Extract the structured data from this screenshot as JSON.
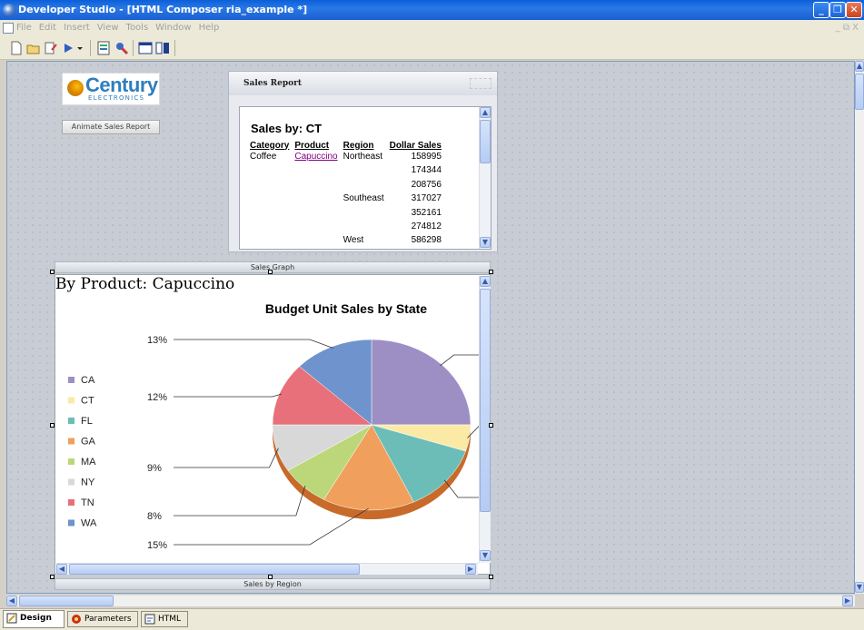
{
  "window": {
    "title": "Developer Studio - [HTML Composer ria_example *]"
  },
  "menu": [
    "File",
    "Edit",
    "Insert",
    "View",
    "Tools",
    "Window",
    "Help"
  ],
  "mdi_controls": "_ ⧉ X",
  "logo": {
    "name": "Century",
    "sub": "ELECTRONICS"
  },
  "animate_button": "Animate Sales Report",
  "report": {
    "frame_title": "Sales Report",
    "title": "Sales by: CT",
    "columns": [
      "Category",
      "Product",
      "Region",
      "Dollar Sales"
    ],
    "rows": [
      [
        "Coffee",
        "Capuccino",
        "Northeast",
        "158995"
      ],
      [
        "",
        "",
        "",
        "174344"
      ],
      [
        "",
        "",
        "",
        "208756"
      ],
      [
        "",
        "",
        "Southeast",
        "317027"
      ],
      [
        "",
        "",
        "",
        "352161"
      ],
      [
        "",
        "",
        "",
        "274812"
      ],
      [
        "",
        "",
        "West",
        "586298"
      ]
    ]
  },
  "graph": {
    "frame_label": "Sales Graph",
    "heading": "By Product: Capuccino",
    "bottom_label": "Sales by Region"
  },
  "chart_data": {
    "type": "pie",
    "title": "Budget Unit Sales by State",
    "legend_position": "left",
    "series": [
      {
        "name": "CA",
        "value": 25,
        "color": "#9d8fc4"
      },
      {
        "name": "CT",
        "value": 5,
        "color": "#fbeaa6"
      },
      {
        "name": "FL",
        "value": 13,
        "color": "#6cbdb8"
      },
      {
        "name": "GA",
        "value": 15,
        "color": "#f0a05c"
      },
      {
        "name": "MA",
        "value": 8,
        "color": "#bcd77a"
      },
      {
        "name": "NY",
        "value": 9,
        "color": "#d8d8d8"
      },
      {
        "name": "TN",
        "value": 12,
        "color": "#e8707a"
      },
      {
        "name": "WA",
        "value": 13,
        "color": "#6f93cc"
      }
    ],
    "visible_labels": [
      "13%",
      "12%",
      "9%",
      "8%",
      "15%"
    ]
  },
  "tabs": [
    {
      "label": "Design"
    },
    {
      "label": "Parameters"
    },
    {
      "label": "HTML"
    }
  ]
}
